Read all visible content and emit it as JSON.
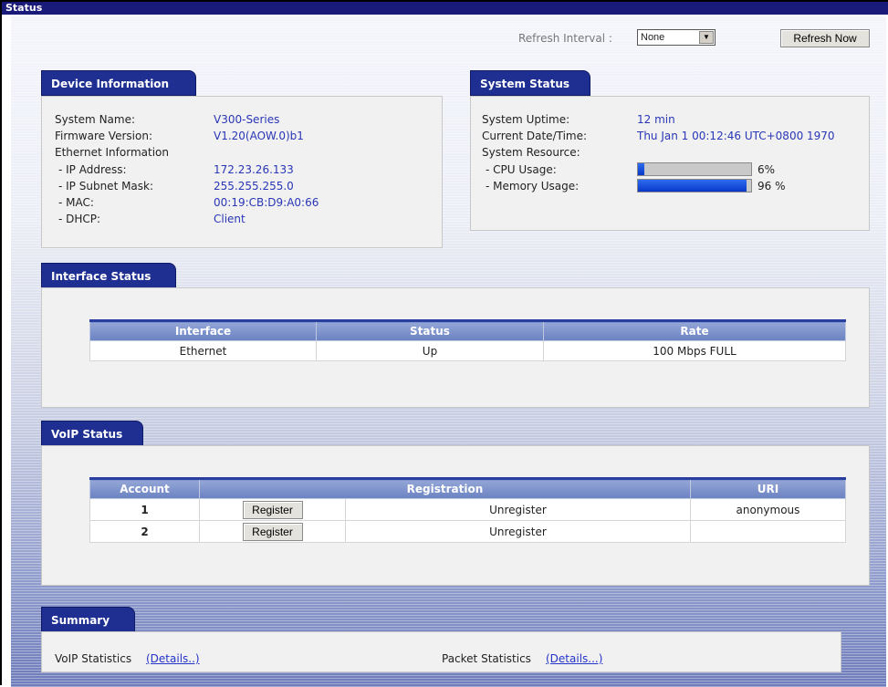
{
  "window": {
    "title": "Status"
  },
  "toolbar": {
    "refresh_interval_label": "Refresh Interval :",
    "refresh_interval_value": "None",
    "refresh_now_label": "Refresh Now"
  },
  "device_info": {
    "tab": "Device Information",
    "system_name_label": "System Name:",
    "system_name": "V300-Series",
    "firmware_label": "Firmware Version:",
    "firmware": "V1.20(AOW.0)b1",
    "ethernet_label": "Ethernet Information",
    "ip_label": "- IP Address:",
    "ip": "172.23.26.133",
    "mask_label": "- IP Subnet Mask:",
    "mask": "255.255.255.0",
    "mac_label": "- MAC:",
    "mac": "00:19:CB:D9:A0:66",
    "dhcp_label": "- DHCP:",
    "dhcp": "Client"
  },
  "system_status": {
    "tab": "System Status",
    "uptime_label": "System Uptime:",
    "uptime": "12 min",
    "datetime_label": "Current Date/Time:",
    "datetime": "Thu Jan 1 00:12:46 UTC+0800 1970",
    "resource_label": "System Resource:",
    "cpu_label": "- CPU Usage:",
    "cpu_text": "6%",
    "cpu_level": 0.06,
    "mem_label": "- Memory Usage:",
    "mem_text": "96 %",
    "mem_level": 0.96
  },
  "interface_status": {
    "tab": "Interface Status",
    "headers": [
      "Interface",
      "Status",
      "Rate"
    ],
    "rows": [
      [
        "Ethernet",
        "Up",
        "100 Mbps FULL"
      ]
    ]
  },
  "voip_status": {
    "tab": "VoIP Status",
    "headers": [
      "Account",
      "Registration",
      "URI"
    ],
    "register_label": "Register",
    "rows": [
      {
        "account": "1",
        "state": "Unregister",
        "uri": "anonymous"
      },
      {
        "account": "2",
        "state": "Unregister",
        "uri": ""
      }
    ]
  },
  "summary": {
    "tab": "Summary",
    "voip_label": "VoIP Statistics",
    "voip_link": "(Details..)",
    "packet_label": "Packet Statistics",
    "packet_link": "(Details...)"
  },
  "colors": {
    "tab": "#1f2f91",
    "value_text": "#2936b6",
    "bar": "#1a4ad8",
    "titlebar": "#1a1a7a"
  }
}
